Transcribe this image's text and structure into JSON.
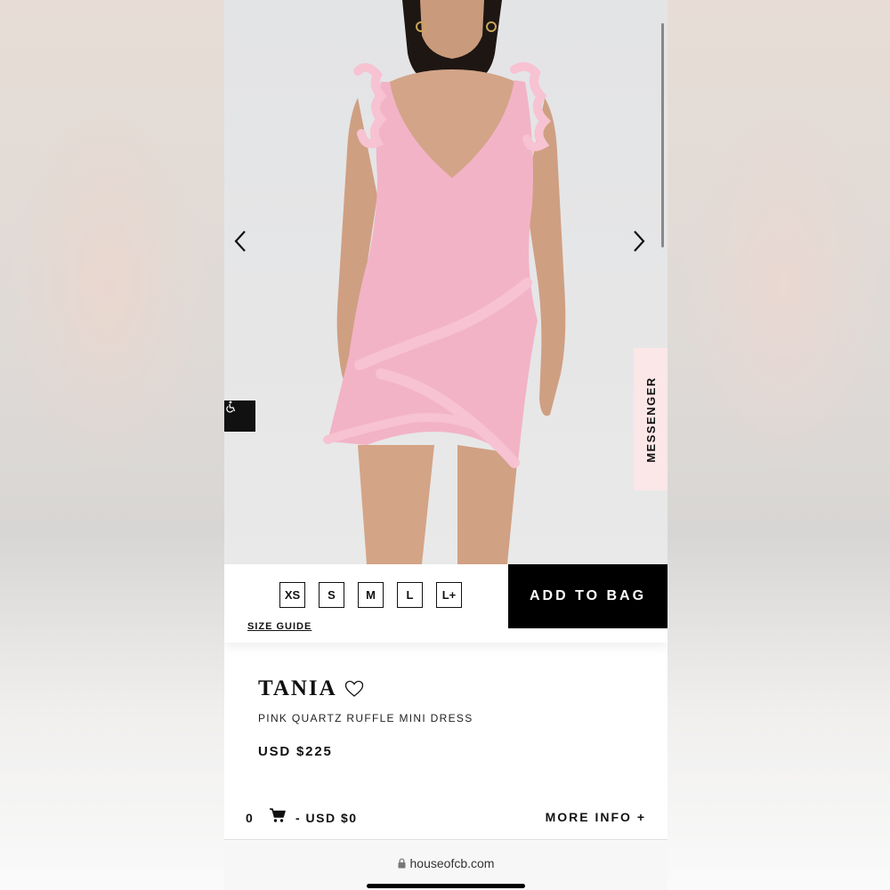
{
  "product": {
    "name": "TANIA",
    "subtitle": "PINK QUARTZ RUFFLE MINI DRESS",
    "price": "USD $225",
    "dress_color": "#f4b6c8",
    "image_alt": "Model wearing pink ruffle mini dress"
  },
  "sizes": [
    "XS",
    "S",
    "M",
    "L",
    "L+"
  ],
  "buy_bar": {
    "size_guide_label": "SIZE GUIDE",
    "add_to_bag_label": "ADD TO BAG"
  },
  "messenger_label": "MESSENGER",
  "cart": {
    "count": "0",
    "total": "- USD $0",
    "more_info_label": "MORE INFO +"
  },
  "browser": {
    "url": "houseofcb.com"
  },
  "icons": {
    "prev": "chevron-left-icon",
    "next": "chevron-right-icon",
    "accessibility": "wheelchair-icon",
    "favorite": "heart-icon",
    "cart": "cart-icon",
    "lock": "lock-icon"
  }
}
